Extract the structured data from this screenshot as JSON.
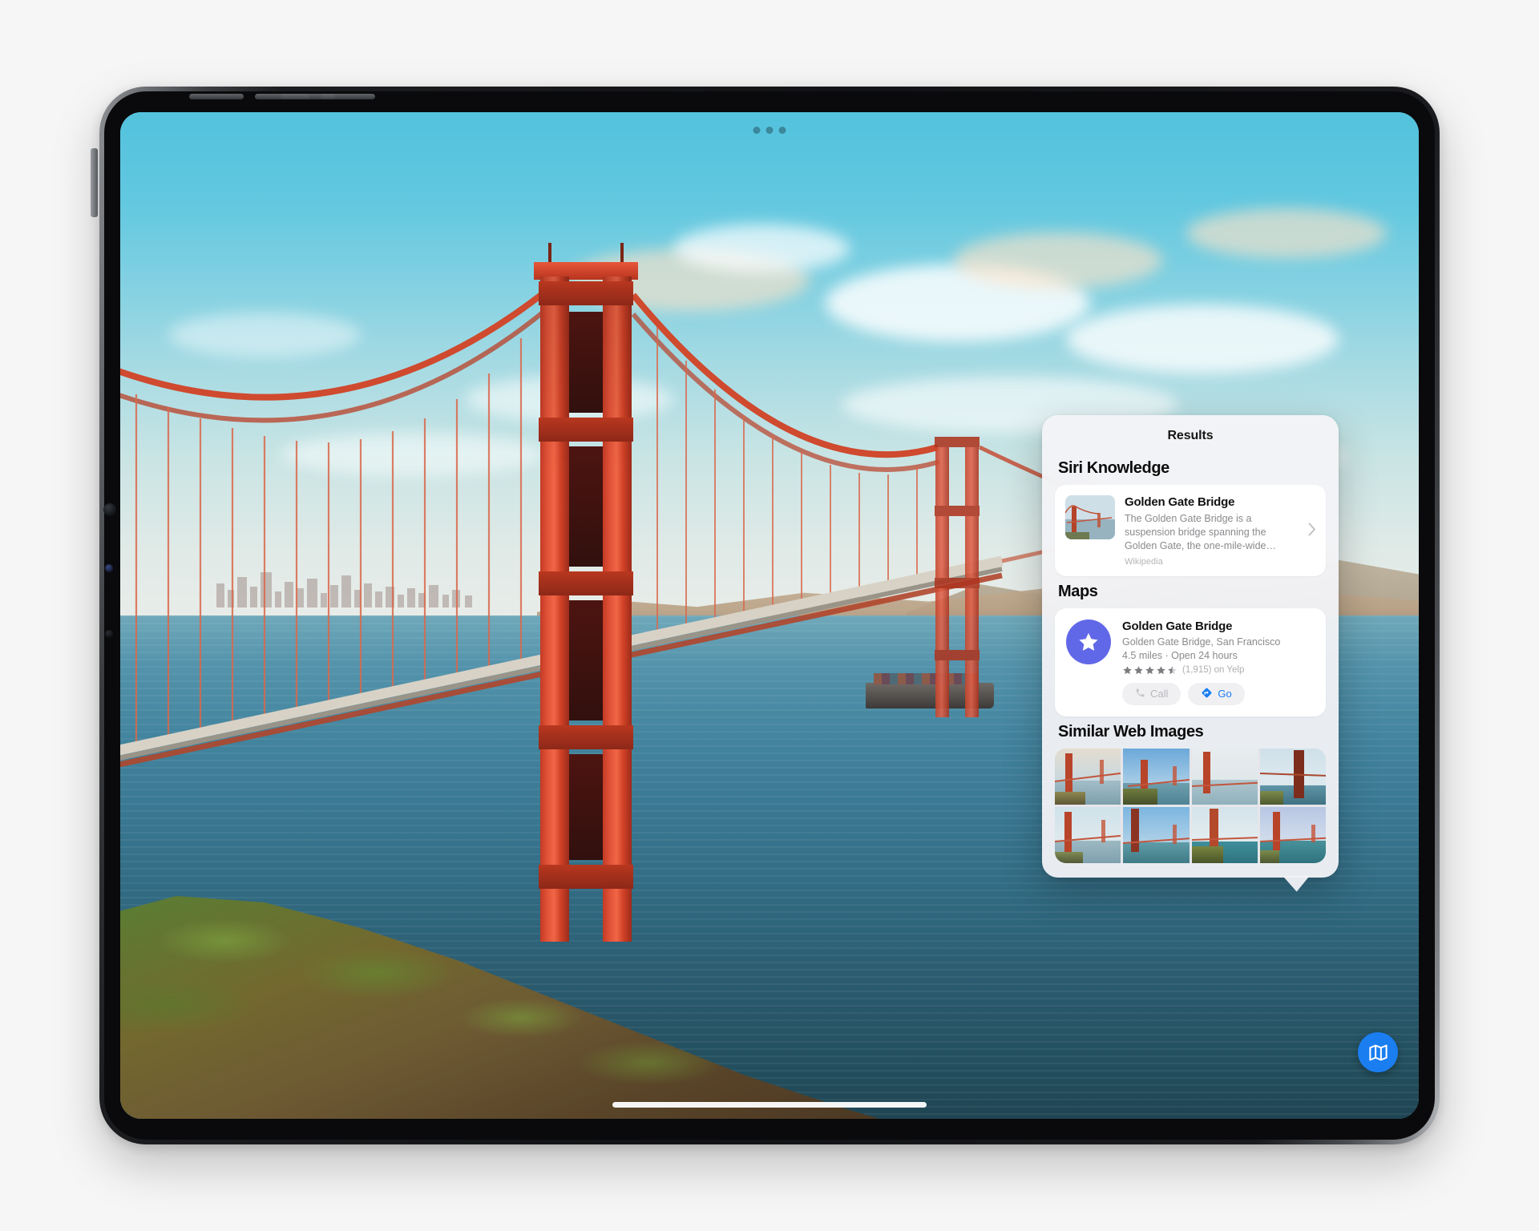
{
  "device": {
    "name": "iPad Pro",
    "chrome": {
      "multitask_handle": "multitasking-dots",
      "home_indicator": "home-indicator"
    }
  },
  "wallpaper": {
    "subject": "Golden Gate Bridge photo"
  },
  "panel": {
    "title": "Results",
    "sections": [
      {
        "id": "siri-knowledge",
        "heading": "Siri Knowledge",
        "item": {
          "title": "Golden Gate Bridge",
          "snippet": "The Golden Gate Bridge is a suspension bridge spanning the Golden Gate, the one-mile-wide…",
          "source": "Wikipedia",
          "thumbnail": "golden-gate-bridge-thumbnail",
          "disclosure_icon": "chevron-right-icon"
        }
      },
      {
        "id": "maps",
        "heading": "Maps",
        "item": {
          "badge_icon": "star-icon",
          "badge_color": "#6168e8",
          "title": "Golden Gate Bridge",
          "address": "Golden Gate Bridge, San Francisco",
          "meta": "4.5 miles · Open 24 hours",
          "rating_value": 4.5,
          "rating_stars": "★★★★⯨",
          "rating_count": "(1,915) on Yelp",
          "actions": [
            {
              "id": "call",
              "label": "Call",
              "icon": "phone-icon",
              "enabled": false
            },
            {
              "id": "go",
              "label": "Go",
              "icon": "directions-icon",
              "enabled": true
            }
          ]
        }
      },
      {
        "id": "similar-web-images",
        "heading": "Similar Web Images",
        "thumbnails": [
          {
            "id": "web-image-1",
            "alt": "Golden Gate Bridge at sunrise"
          },
          {
            "id": "web-image-2",
            "alt": "Golden Gate Bridge with clouds"
          },
          {
            "id": "web-image-3",
            "alt": "Golden Gate Bridge in fog"
          },
          {
            "id": "web-image-4",
            "alt": "Golden Gate Bridge tower with city"
          },
          {
            "id": "web-image-5",
            "alt": "Golden Gate Bridge hazy morning"
          },
          {
            "id": "web-image-6",
            "alt": "Golden Gate Bridge blue sky"
          },
          {
            "id": "web-image-7",
            "alt": "Golden Gate Bridge from Marin"
          },
          {
            "id": "web-image-8",
            "alt": "Golden Gate Bridge wide view"
          }
        ]
      }
    ]
  },
  "fab": {
    "id": "maps-app-button",
    "icon": "map-icon",
    "color": "#1a7ef0"
  },
  "colors": {
    "accent_blue": "#1a7ef0",
    "maps_badge": "#6168e8",
    "panel_bg": "#f3f3f6",
    "card_bg": "#ffffff",
    "title_text": "#121212",
    "secondary_text": "#8a8a8e",
    "tertiary_text": "#b4b4b8"
  }
}
